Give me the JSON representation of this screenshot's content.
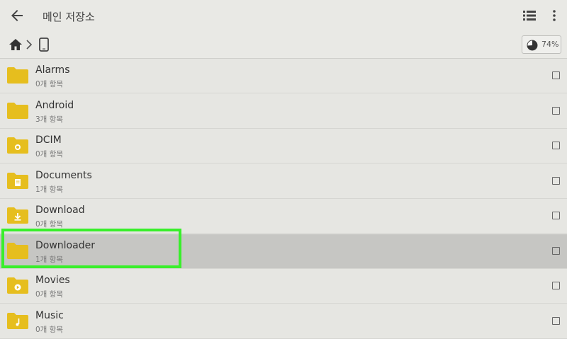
{
  "appbar": {
    "title": "메인 저장소"
  },
  "pathbar": {
    "storage_percent": "74%",
    "storage_used_fraction": 0.74
  },
  "folders": [
    {
      "name": "Alarms",
      "count": "0개 항목",
      "icon": "folder-icon"
    },
    {
      "name": "Android",
      "count": "3개 항목",
      "icon": "folder-icon"
    },
    {
      "name": "DCIM",
      "count": "0개 항목",
      "icon": "camera-folder-icon"
    },
    {
      "name": "Documents",
      "count": "1개 항목",
      "icon": "document-folder-icon"
    },
    {
      "name": "Download",
      "count": "0개 항목",
      "icon": "download-folder-icon"
    },
    {
      "name": "Downloader",
      "count": "1개 항목",
      "icon": "folder-icon",
      "selected": true
    },
    {
      "name": "Movies",
      "count": "0개 항목",
      "icon": "movie-folder-icon"
    },
    {
      "name": "Music",
      "count": "0개 항목",
      "icon": "music-folder-icon"
    }
  ],
  "colors": {
    "folder": "#e6be1e",
    "highlight": "#39ef2b",
    "selected_row": "#c6c6c3"
  }
}
